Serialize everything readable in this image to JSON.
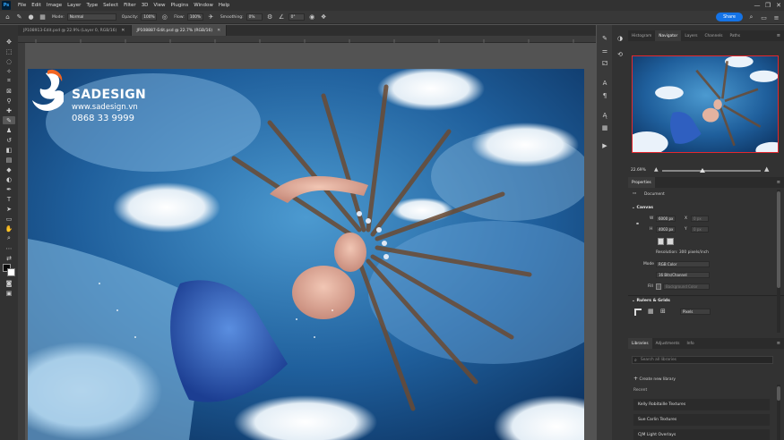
{
  "menubar": {
    "app_icon": "Ps",
    "items": [
      "File",
      "Edit",
      "Image",
      "Layer",
      "Type",
      "Select",
      "Filter",
      "3D",
      "View",
      "Plugins",
      "Window",
      "Help"
    ],
    "window_controls": [
      "—",
      "❐",
      "✕"
    ]
  },
  "options": {
    "mode_label": "Mode:",
    "mode_value": "Normal",
    "opacity_label": "Opacity:",
    "opacity_value": "100%",
    "flow_label": "Flow:",
    "flow_value": "100%",
    "smoothing_label": "Smoothing:",
    "smoothing_value": "0%",
    "angle_value": "0°",
    "share_label": "Share"
  },
  "tabs": [
    {
      "label": "JP108913-Edit.psd @ 22.9% (Layer 0, RGB/16)",
      "active": false
    },
    {
      "label": "JP108887-Edit.psd @ 22.7% (RGB/16)",
      "active": true
    }
  ],
  "watermark": {
    "brand": "SADESIGN",
    "url": "www.sadesign.vn",
    "phone": "0868 33 9999"
  },
  "panels": {
    "top_tabs": [
      "Histogram",
      "Navigator",
      "Layers",
      "Channels",
      "Paths"
    ],
    "top_active": "Navigator",
    "navigator_zoom": "22.69%",
    "properties_tab": "Properties",
    "properties": {
      "document_label": "Document",
      "canvas_header": "Canvas",
      "w_label": "W",
      "w_value": "6000 px",
      "x_label": "X",
      "x_value": "0 px",
      "h_label": "H",
      "h_value": "4003 px",
      "y_label": "Y",
      "y_value": "0 px",
      "resolution": "Resolution: 300 pixels/inch",
      "mode_label": "Mode",
      "mode_value": "RGB Color",
      "depth_value": "16 Bits/Channel",
      "fill_label": "Fill",
      "fill_value": "Background Color",
      "rulers_header": "Rulers & Grids",
      "units_value": "Pixels"
    },
    "bottom_tabs": [
      "Libraries",
      "Adjustments",
      "Info"
    ],
    "bottom_active": "Libraries",
    "library_search_placeholder": "Search all libraries",
    "create_library": "Create new library",
    "recent_label": "Recent",
    "library_items": [
      "Kelly Robitaille Textures",
      "Sue Carlin Textures",
      "CJM Light Overlays"
    ]
  },
  "colors": {
    "accent": "#1473e6",
    "nav_frame": "#e4282f",
    "brand_orange": "#f26522"
  }
}
